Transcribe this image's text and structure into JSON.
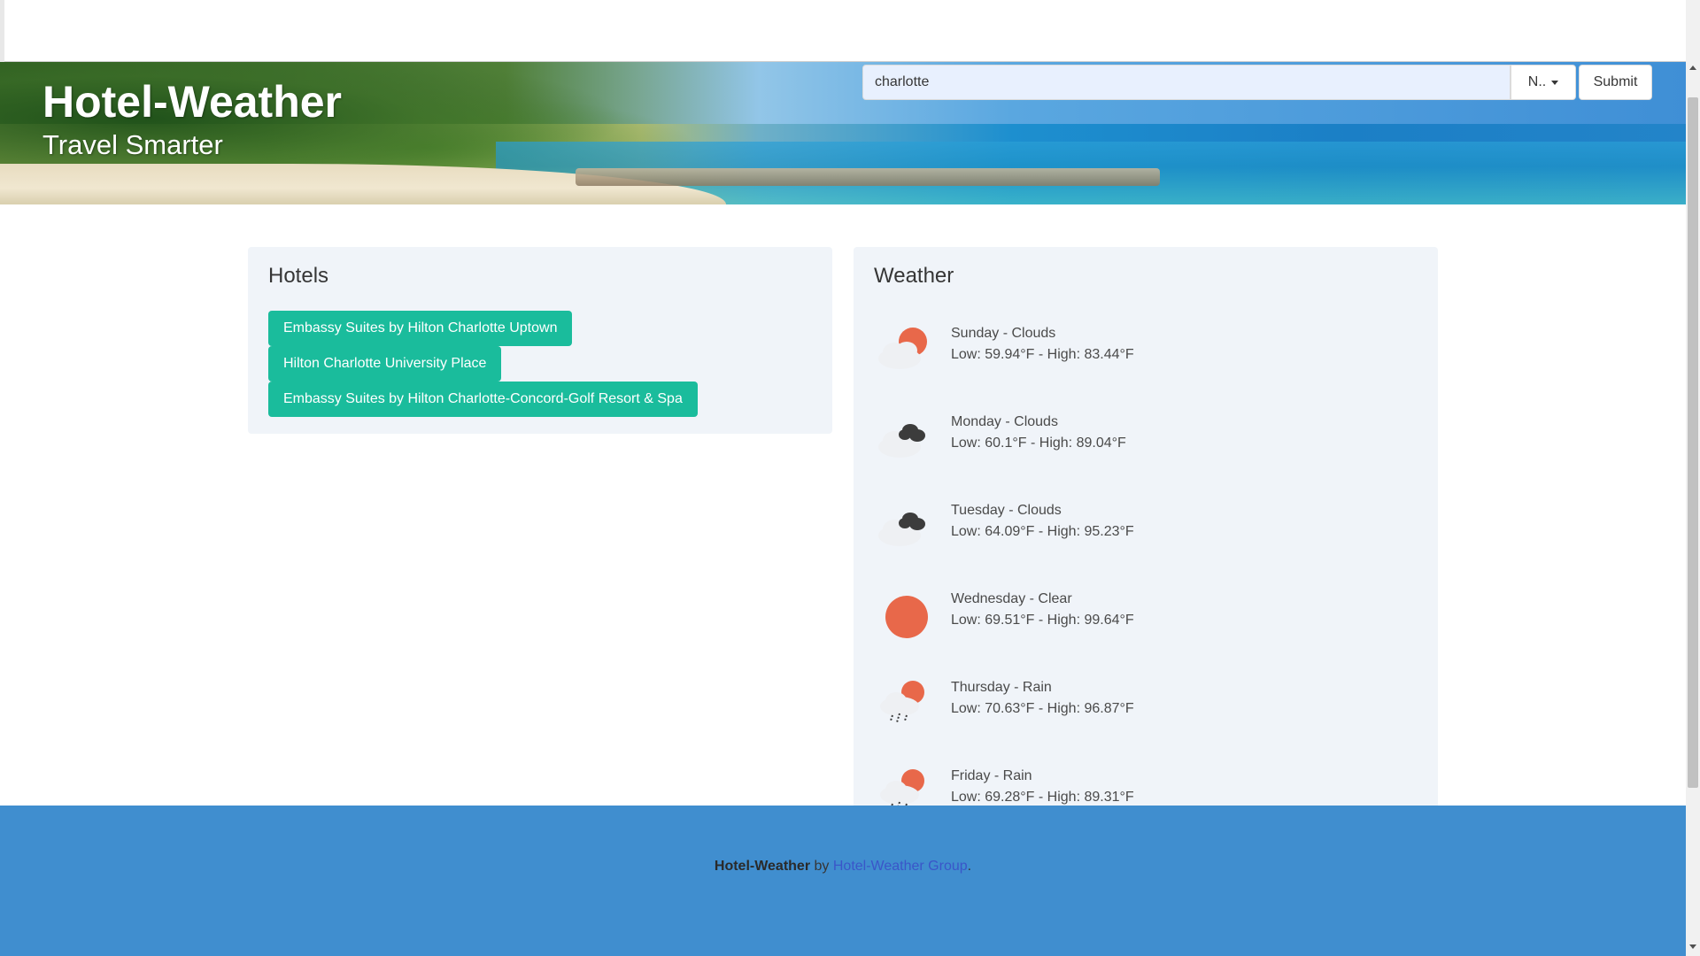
{
  "header": {
    "title": "Hotel-Weather",
    "subtitle": "Travel Smarter"
  },
  "search": {
    "value": "charlotte",
    "dropdown_label": "N..",
    "submit_label": "Submit"
  },
  "hotels": {
    "title": "Hotels",
    "items": [
      "Embassy Suites by Hilton Charlotte Uptown",
      "Hilton Charlotte University Place",
      "Embassy Suites by Hilton Charlotte-Concord-Golf Resort & Spa"
    ]
  },
  "weather": {
    "title": "Weather",
    "days": [
      {
        "label": "Sunday - Clouds",
        "temps": "Low: 59.94°F - High: 83.44°F",
        "icon": "partly-cloudy-day-icon"
      },
      {
        "label": "Monday - Clouds",
        "temps": "Low: 60.1°F - High: 89.04°F",
        "icon": "cloudy-icon"
      },
      {
        "label": "Tuesday - Clouds",
        "temps": "Low: 64.09°F - High: 95.23°F",
        "icon": "cloudy-icon"
      },
      {
        "label": "Wednesday - Clear",
        "temps": "Low: 69.51°F - High: 99.64°F",
        "icon": "sun-icon"
      },
      {
        "label": "Thursday - Rain",
        "temps": "Low: 70.63°F - High: 96.87°F",
        "icon": "rain-icon"
      },
      {
        "label": "Friday - Rain",
        "temps": "Low: 69.28°F - High: 89.31°F",
        "icon": "rain-icon"
      }
    ]
  },
  "footer": {
    "brand": "Hotel-Weather",
    "by": " by ",
    "link": "Hotel-Weather Group",
    "end": "."
  },
  "colors": {
    "accent": "#1abc9c",
    "footer_bg": "#408ecf",
    "panel_bg": "#f0f4f9",
    "sun": "#e8684a"
  }
}
